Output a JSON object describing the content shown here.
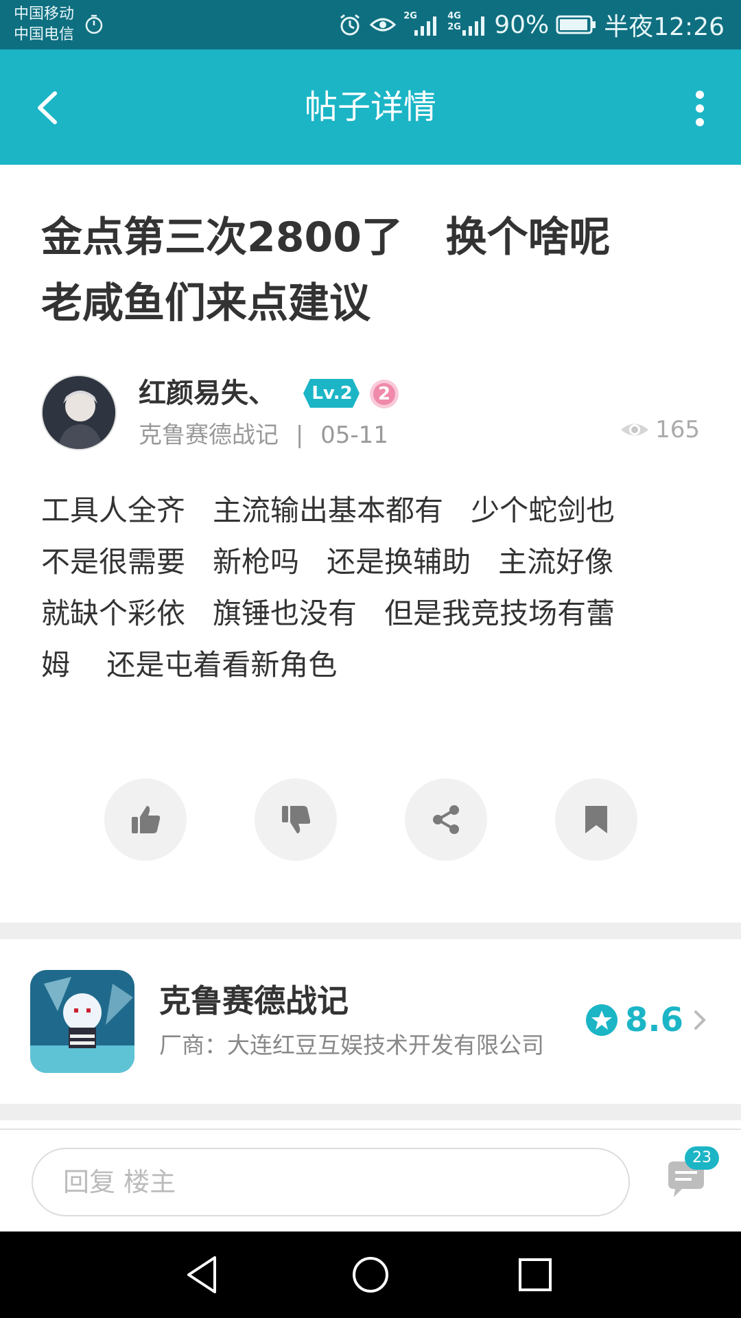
{
  "status_bar": {
    "carrier1": "中国移动",
    "carrier2": "中国电信",
    "net1": "2G",
    "net2": "4G",
    "net3": "2G",
    "battery": "90%",
    "time": "半夜12:26"
  },
  "header": {
    "title": "帖子详情"
  },
  "post": {
    "title": "金点第三次2800了   换个啥呢\n老咸鱼们来点建议",
    "author": "红颜易失、",
    "level": "Lv.2",
    "medal": "2",
    "game": "克鲁赛德战记",
    "separator": "|",
    "date": "05-11",
    "views": "165",
    "body": "工具人全齐   主流输出基本都有   少个蛇剑也\n不是很需要   新枪吗   还是换辅助   主流好像\n就缺个彩依   旗锤也没有   但是我竞技场有蕾\n姆    还是屯着看新角色"
  },
  "actions": {
    "like_icon": "thumbs-up-icon",
    "dislike_icon": "thumbs-down-icon",
    "share_icon": "share-icon",
    "bookmark_icon": "bookmark-icon"
  },
  "game_card": {
    "name": "克鲁赛德战记",
    "developer": "厂商：大连红豆互娱技术开发有限公司",
    "score": "8.6"
  },
  "reply": {
    "placeholder": "回复  楼主",
    "comment_count": "23"
  },
  "colors": {
    "accent": "#1bb5c6",
    "status_bar": "#0e6f80"
  }
}
